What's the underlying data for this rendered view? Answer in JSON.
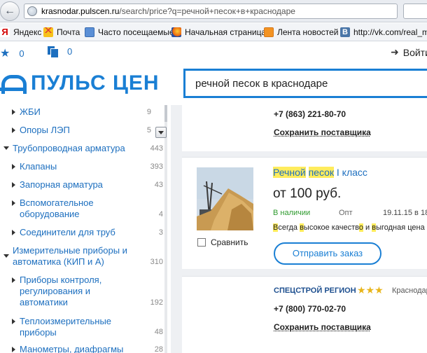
{
  "browser": {
    "url_host": "krasnodar.pulscen.ru",
    "url_path": "/search/price?q=речной+песок+в+краснодаре"
  },
  "bookmarks": [
    {
      "label": "Яндекс",
      "icon": "yandex-icon"
    },
    {
      "label": "Почта",
      "icon": "mail-icon"
    },
    {
      "label": "Часто посещаемые",
      "icon": "folder-icon"
    },
    {
      "label": "Начальная страница",
      "icon": "firefox-icon"
    },
    {
      "label": "Лента новостей",
      "icon": "rss-icon"
    },
    {
      "label": "http://vk.com/real_m",
      "icon": "vk-icon"
    }
  ],
  "site_top": {
    "favorites_count": "0",
    "compare_count": "0",
    "login_label": "Войти"
  },
  "header": {
    "logo_text": "ПУЛЬС ЦЕН",
    "search_value": "речной песок в краснодаре"
  },
  "sidebar": {
    "items": [
      {
        "label": "ЖБИ",
        "count": "9"
      },
      {
        "label": "Опоры ЛЭП",
        "count": "5"
      },
      {
        "label": "Трубопроводная арматура",
        "count": "443"
      },
      {
        "label": "Клапаны",
        "count": "393"
      },
      {
        "label": "Запорная арматура",
        "count": "43"
      },
      {
        "label_1": "Вспомогательное",
        "label_2": "оборудование",
        "count": "4"
      },
      {
        "label": "Соединители для труб",
        "count": "3"
      },
      {
        "label_1": "Измерительные приборы и",
        "label_2": "автоматика (КИП и А)",
        "count": "310"
      },
      {
        "label_1": "Приборы контроля,",
        "label_2": "регулирования и",
        "label_3": "автоматики",
        "count": "192"
      },
      {
        "label_1": "Теплоизмерительные",
        "label_2": "приборы",
        "count": "48"
      },
      {
        "label": "Манометры, диафрагмы",
        "count": "28"
      }
    ]
  },
  "listing_top": {
    "phone": "+7 (863) 221-80-70",
    "save_label": "Сохранить поставщика"
  },
  "product": {
    "title_hl1": "Речной",
    "title_hl2": "песок",
    "title_rest": " I класс",
    "price": "от 100 руб.",
    "availability": "В наличии",
    "wholesale": "Опт",
    "date": "19.11.15 в 18",
    "desc_parts": [
      "В",
      "сегда ",
      "в",
      "ысокое качеств",
      "о",
      " и ",
      "в",
      "ыгодная цена"
    ],
    "compare_label": "Сравнить",
    "order_label": "Отправить заказ",
    "colors": {
      "availability": "#2e9a2e",
      "accent": "#1a7fd4",
      "highlight": "#ffec5c"
    }
  },
  "supplier": {
    "name": "СПЕЦСТРОЙ РЕГИОН",
    "stars": "★★★",
    "city": "Краснодар",
    "phone": "+7 (800) 770-02-70",
    "save_label": "Сохранить поставщика"
  }
}
